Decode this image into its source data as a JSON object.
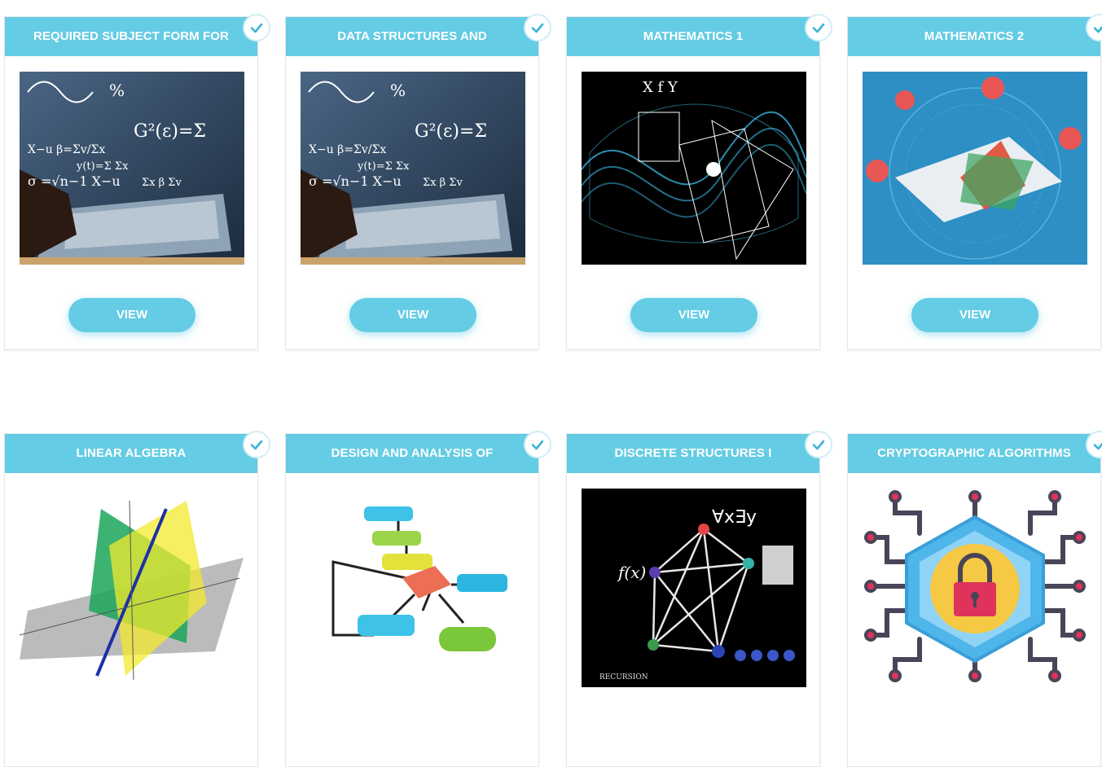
{
  "courses": [
    {
      "title": "REQUIRED SUBJECT FORM FOR",
      "button": "VIEW",
      "image": "math-laptop",
      "completed": true
    },
    {
      "title": "DATA STRUCTURES AND",
      "button": "VIEW",
      "image": "math-laptop",
      "completed": true
    },
    {
      "title": "MATHEMATICS 1",
      "button": "VIEW",
      "image": "math-waves",
      "completed": true
    },
    {
      "title": "MATHEMATICS 2",
      "button": "VIEW",
      "image": "math-planes-circle",
      "completed": true
    },
    {
      "title": "LINEAR ALGEBRA",
      "button": "",
      "image": "linear-planes",
      "completed": true
    },
    {
      "title": "DESIGN AND ANALYSIS OF",
      "button": "",
      "image": "flowchart",
      "completed": true
    },
    {
      "title": "DISCRETE STRUCTURES I",
      "button": "",
      "image": "graph-network",
      "completed": true
    },
    {
      "title": "CRYPTOGRAPHIC ALGORITHMS",
      "button": "",
      "image": "lock-circuit",
      "completed": true
    }
  ],
  "graph_image_text": {
    "formula": "∀x∃y",
    "fx": "f(x)",
    "recursion": "RECURSION"
  },
  "colors": {
    "accent": "#64cce4",
    "check": "#3ab3d8"
  }
}
